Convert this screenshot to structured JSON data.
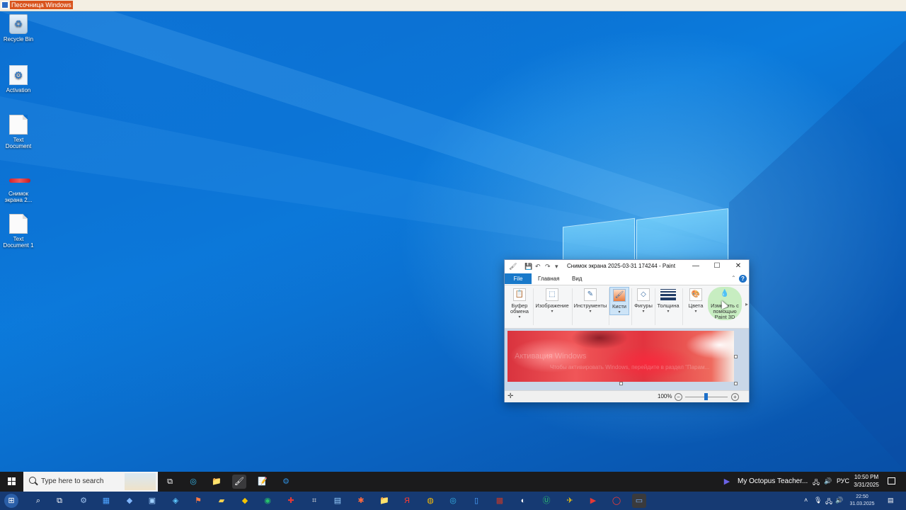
{
  "sandbox": {
    "title": "Песочница Windows"
  },
  "desktop": {
    "icons": [
      {
        "label": "Recycle Bin",
        "icon": "recycle-bin-icon"
      },
      {
        "label": "Activation",
        "icon": "activation-icon"
      },
      {
        "label": "Text Document",
        "icon": "text-document-icon"
      },
      {
        "label": "Снимок экрана 2...",
        "icon": "screenshot-file-icon"
      },
      {
        "label": "Text Document 1",
        "icon": "text-document-icon"
      }
    ]
  },
  "paint": {
    "title": "Снимок экрана 2025-03-31 174244 - Paint",
    "tabs": {
      "file": "File",
      "home": "Главная",
      "view": "Вид"
    },
    "groups": {
      "clipboard": "Буфер обмена",
      "image": "Изображение",
      "tools": "Инструменты",
      "brushes": "Кисти",
      "shapes": "Фигуры",
      "thickness": "Толщина",
      "colors": "Цвета",
      "edit3d": "Изменить с помощью Paint 3D"
    },
    "canvas": {
      "watermark_title": "Активация Windows",
      "watermark_sub": "Чтобы активировать Windows, перейдите в раздел \"Парам..."
    },
    "status": {
      "zoom": "100%"
    }
  },
  "taskbar": {
    "search_placeholder": "Type here to search",
    "running_app": "My Octopus Teacher...",
    "language": "РУС",
    "time": "10:50 PM",
    "date": "3/31/2025"
  },
  "host_taskbar": {
    "time": "22:50",
    "date": "31.03.2025"
  },
  "colors": {
    "desktop_accent": "#0a66c8",
    "file_tab": "#1979ca",
    "sandbox_title_bg": "#d9541e"
  }
}
